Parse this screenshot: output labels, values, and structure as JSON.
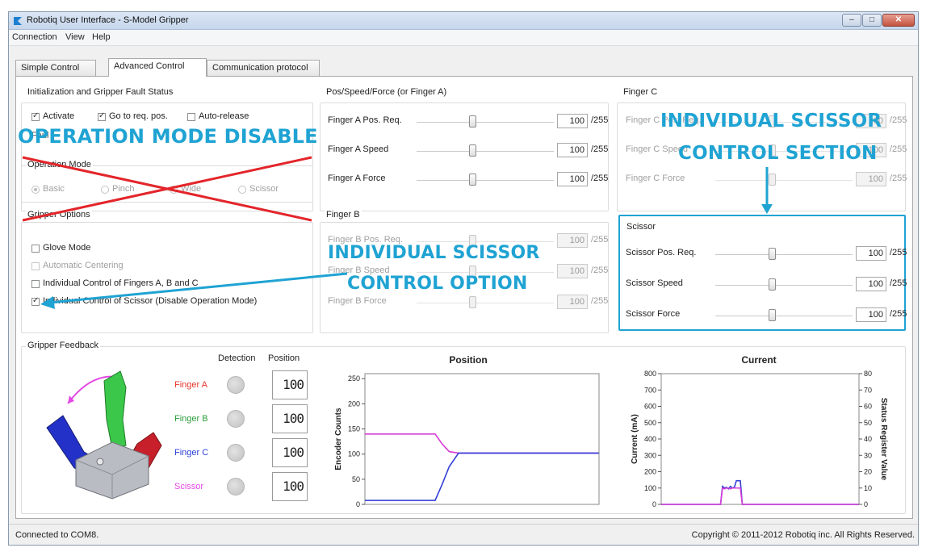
{
  "window": {
    "title": "Robotiq User Interface - S-Model Gripper",
    "min": "–",
    "max": "□",
    "close": "✕"
  },
  "menu": [
    "Connection",
    "View",
    "Help"
  ],
  "tabs": [
    "Simple Control",
    "Advanced Control",
    "Communication protocol"
  ],
  "init": {
    "title": "Initialization and Gripper Fault Status",
    "activate": "Activate",
    "goto": "Go to req. pos.",
    "autorelease": "Auto-release",
    "fault_prefix": "Faul"
  },
  "opmode": {
    "title": "Operation Mode",
    "options": [
      "Basic",
      "Pinch",
      "Wide",
      "Scissor"
    ]
  },
  "options": {
    "title": "Gripper Options",
    "items": [
      "Glove Mode",
      "Automatic Centering",
      "Individual Control of Fingers A, B and C",
      "Individual Control of Scissor (Disable Operation Mode)"
    ]
  },
  "fingerA": {
    "title": "Pos/Speed/Force (or Finger A)",
    "rows": [
      "Finger A Pos. Req.",
      "Finger A Speed",
      "Finger A Force"
    ],
    "value": "100",
    "max": "/255"
  },
  "fingerB": {
    "title": "Finger B",
    "rows": [
      "Finger B Pos. Req.",
      "Finger B Speed",
      "Finger B Force"
    ],
    "value": "100",
    "max": "/255"
  },
  "fingerC": {
    "title": "Finger C",
    "rows": [
      "Finger C Pos. Req.",
      "Finger C Speed",
      "Finger C Force"
    ],
    "value": "100",
    "max": "/255"
  },
  "scissor": {
    "title": "Scissor",
    "rows": [
      "Scissor Pos. Req.",
      "Scissor Speed",
      "Scissor Force"
    ],
    "value": "100",
    "max": "/255"
  },
  "annotations": {
    "opmode_disable": "OPERATION MODE DISABLE",
    "section_line1": "INDIVIDUAL SCISSOR",
    "section_line2": "CONTROL SECTION",
    "option_line1": "INDIVIDUAL SCISSOR",
    "option_line2": "CONTROL OPTION",
    "color": "#1fa3d3"
  },
  "feedback": {
    "title": "Gripper Feedback",
    "col_detection": "Detection",
    "col_position": "Position",
    "fingers": [
      {
        "name": "Finger A",
        "color": "#e8352b",
        "value": "100"
      },
      {
        "name": "Finger B",
        "color": "#2a9e3a",
        "value": "100"
      },
      {
        "name": "Finger C",
        "color": "#2b3fd6",
        "value": "100"
      },
      {
        "name": "Scissor",
        "color": "#e447e4",
        "value": "100"
      }
    ]
  },
  "chart_data": [
    {
      "type": "line",
      "title": "Position",
      "ylabel": "Encoder Counts",
      "xlabel": "",
      "ylim": [
        0,
        260
      ],
      "yticks": [
        0,
        50,
        100,
        150,
        200,
        250
      ],
      "x": [
        0,
        10,
        20,
        30,
        33,
        36,
        40,
        50,
        60,
        70,
        80,
        90,
        100
      ],
      "series": [
        {
          "color": "#d83cd8",
          "values": [
            140,
            140,
            140,
            140,
            120,
            105,
            102,
            102,
            102,
            102,
            102,
            102,
            102
          ]
        },
        {
          "color": "#3340d6",
          "values": [
            8,
            8,
            8,
            8,
            40,
            75,
            102,
            102,
            102,
            102,
            102,
            102,
            102
          ]
        }
      ]
    },
    {
      "type": "line",
      "title": "Current",
      "ylabel": "Current (mA)",
      "y2label": "Status Register Value",
      "ylim": [
        0,
        800
      ],
      "yticks": [
        0,
        100,
        200,
        300,
        400,
        500,
        600,
        700,
        800
      ],
      "y2ticks": [
        0,
        10,
        20,
        30,
        40,
        50,
        60,
        70,
        80
      ],
      "x": [
        0,
        10,
        20,
        28,
        30,
        31,
        32,
        33,
        34,
        35,
        36,
        37,
        38,
        40,
        41,
        42,
        50,
        60,
        70,
        80,
        90,
        100
      ],
      "series": [
        {
          "color": "#3340d6",
          "values": [
            0,
            0,
            0,
            0,
            0,
            110,
            100,
            105,
            95,
            110,
            100,
            105,
            145,
            145,
            0,
            0,
            0,
            0,
            0,
            0,
            0,
            0
          ]
        },
        {
          "color": "#d83cd8",
          "values": [
            0,
            0,
            0,
            0,
            0,
            100,
            95,
            100,
            100,
            95,
            100,
            100,
            100,
            100,
            0,
            0,
            0,
            0,
            0,
            0,
            0,
            0
          ]
        }
      ]
    }
  ],
  "status": {
    "left": "Connected to COM8.",
    "right": "Copyright © 2011-2012 Robotiq inc. All Rights Reserved."
  }
}
